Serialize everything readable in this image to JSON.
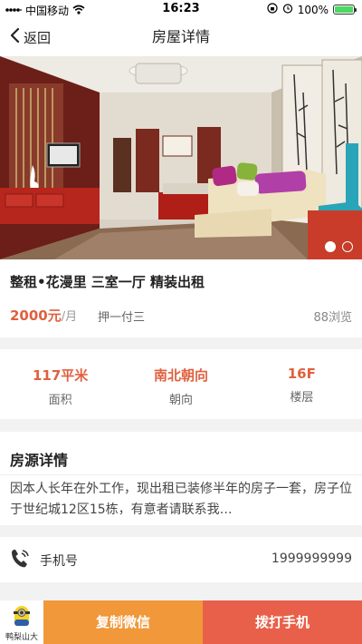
{
  "status_bar": {
    "carrier": "中国移动",
    "time": "16:23",
    "battery": "100%",
    "battery_level": 1.0
  },
  "nav": {
    "back_label": "返回",
    "title": "房屋详情"
  },
  "carousel": {
    "current": 1,
    "total": 2
  },
  "listing": {
    "title": "整租•花漫里 三室一厅 精装出租",
    "price": "2000元",
    "price_unit": "/月",
    "payment": "押一付三",
    "views": "88浏览"
  },
  "stats": [
    {
      "value": "117平米",
      "label": "面积"
    },
    {
      "value": "南北朝向",
      "label": "朝向"
    },
    {
      "value": "16F",
      "label": "楼层"
    }
  ],
  "details": {
    "heading": "房源详情",
    "text": "因本人长年在外工作，现出租已装修半年的房子一套，房子位于世纪城12区15栋，有意者请联系我…"
  },
  "contact": {
    "label": "手机号",
    "number": "1999999999"
  },
  "footer": {
    "user_name": "鸭梨山大",
    "copy_wechat": "复制微信",
    "call_phone": "拨打手机"
  },
  "colors": {
    "accent": "#e0603e",
    "wechat_button": "#f0983a",
    "call_button": "#e9604a"
  }
}
